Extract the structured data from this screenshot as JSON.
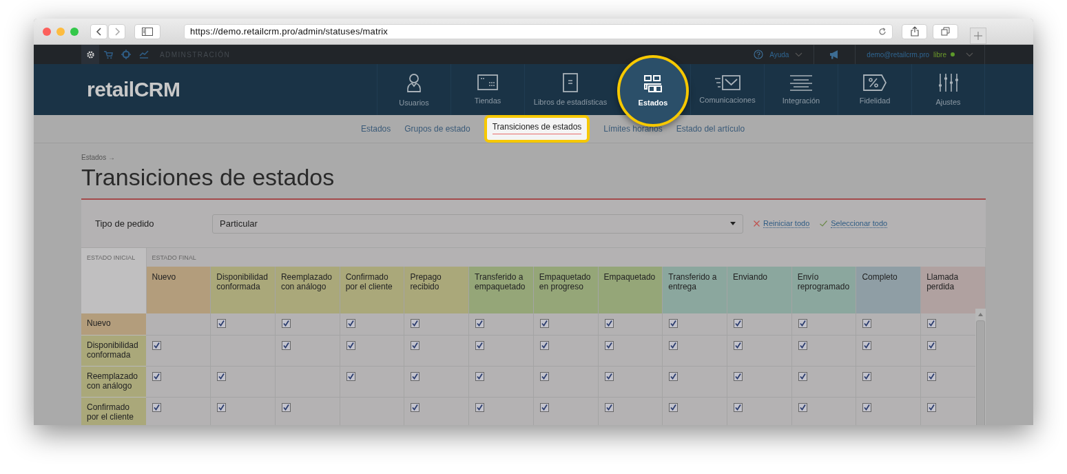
{
  "browser": {
    "url": "https://demo.retailcrm.pro/admin/statuses/matrix"
  },
  "admin_bar": {
    "tools": [
      {
        "selected": true
      },
      {
        "selected": false
      },
      {
        "selected": false
      },
      {
        "selected": false
      }
    ],
    "section": "ADMINSTRACIÓN",
    "help": "Ayuda",
    "user": "demo@retailcrm.pro",
    "plan": "libre"
  },
  "logo": "retailCRM",
  "nav": [
    {
      "label": "Usuarios",
      "selected": false
    },
    {
      "label": "Tiendas",
      "selected": false
    },
    {
      "label": "Libros de estadísticas",
      "selected": false
    },
    {
      "label": "Estados",
      "selected": true
    },
    {
      "label": "Comunicaciones",
      "selected": false
    },
    {
      "label": "Integración",
      "selected": false
    },
    {
      "label": "Fidelidad",
      "selected": false
    },
    {
      "label": "Ajustes",
      "selected": false
    }
  ],
  "subnav": [
    {
      "label": "Estados",
      "selected": false
    },
    {
      "label": "Grupos de estado",
      "selected": false
    },
    {
      "label": "Transiciones de estados",
      "selected": true
    },
    {
      "label": "Límites horarios",
      "selected": false
    },
    {
      "label": "Estado del artículo",
      "selected": false
    }
  ],
  "breadcrumb": "Estados →",
  "title": "Transiciones de estados",
  "filter": {
    "label": "Tipo de pedido",
    "value": "Particular",
    "reset": "Reiniciar todo",
    "select_all": "Seleccionar todo"
  },
  "matrix": {
    "initial_label": "ESTADO INICIAL",
    "final_label": "ESTADO FINAL",
    "columns": [
      {
        "label": "Nuevo",
        "color": "#b39d7c"
      },
      {
        "label": "Disponibilidad conformada",
        "color": "#aaa87a"
      },
      {
        "label": "Reemplazado con análogo",
        "color": "#aaa87a"
      },
      {
        "label": "Confirmado por el cliente",
        "color": "#aaa87a"
      },
      {
        "label": "Prepago recibido",
        "color": "#aaa87a"
      },
      {
        "label": "Transferido a empaquetado",
        "color": "#95a678"
      },
      {
        "label": "Empaquetado en progreso",
        "color": "#95a678"
      },
      {
        "label": "Empaquetado",
        "color": "#95a678"
      },
      {
        "label": "Transferido a entrega",
        "color": "#8ba79e"
      },
      {
        "label": "Enviando",
        "color": "#8ba79e"
      },
      {
        "label": "Envío reprogramado",
        "color": "#8ba79e"
      },
      {
        "label": "Completo",
        "color": "#8f9ea5"
      },
      {
        "label": "Llamada perdida",
        "color": "#b0a1a0"
      }
    ],
    "rows": [
      {
        "label": "Nuevo",
        "color": "#b39d7c",
        "cells": [
          {
            "kind": "empty"
          },
          {
            "kind": "checkbox",
            "checked": true
          },
          {
            "kind": "checkbox",
            "checked": true
          },
          {
            "kind": "checkbox",
            "checked": true
          },
          {
            "kind": "checkbox",
            "checked": true
          },
          {
            "kind": "checkbox",
            "checked": true
          },
          {
            "kind": "checkbox",
            "checked": true
          },
          {
            "kind": "checkbox",
            "checked": true
          },
          {
            "kind": "checkbox",
            "checked": true
          },
          {
            "kind": "checkbox",
            "checked": true
          },
          {
            "kind": "checkbox",
            "checked": true
          },
          {
            "kind": "checkbox",
            "checked": true
          },
          {
            "kind": "checkbox",
            "checked": true
          }
        ]
      },
      {
        "label": "Disponibilidad conformada",
        "color": "#aaa87a",
        "cells": [
          {
            "kind": "checkbox",
            "checked": true
          },
          {
            "kind": "empty"
          },
          {
            "kind": "checkbox",
            "checked": true
          },
          {
            "kind": "checkbox",
            "checked": true
          },
          {
            "kind": "checkbox",
            "checked": true
          },
          {
            "kind": "checkbox",
            "checked": true
          },
          {
            "kind": "checkbox",
            "checked": true
          },
          {
            "kind": "checkbox",
            "checked": true
          },
          {
            "kind": "checkbox",
            "checked": true
          },
          {
            "kind": "checkbox",
            "checked": true
          },
          {
            "kind": "checkbox",
            "checked": true
          },
          {
            "kind": "checkbox",
            "checked": true
          },
          {
            "kind": "checkbox",
            "checked": true
          }
        ]
      },
      {
        "label": "Reemplazado con análogo",
        "color": "#aaa87a",
        "cells": [
          {
            "kind": "checkbox",
            "checked": true
          },
          {
            "kind": "checkbox",
            "checked": true
          },
          {
            "kind": "empty"
          },
          {
            "kind": "checkbox",
            "checked": true
          },
          {
            "kind": "checkbox",
            "checked": true
          },
          {
            "kind": "checkbox",
            "checked": true
          },
          {
            "kind": "checkbox",
            "checked": true
          },
          {
            "kind": "checkbox",
            "checked": true
          },
          {
            "kind": "checkbox",
            "checked": true
          },
          {
            "kind": "checkbox",
            "checked": true
          },
          {
            "kind": "checkbox",
            "checked": true
          },
          {
            "kind": "checkbox",
            "checked": true
          },
          {
            "kind": "checkbox",
            "checked": true
          }
        ]
      },
      {
        "label": "Confirmado por el cliente",
        "color": "#aaa87a",
        "cells": [
          {
            "kind": "checkbox",
            "checked": true
          },
          {
            "kind": "checkbox",
            "checked": true
          },
          {
            "kind": "checkbox",
            "checked": true
          },
          {
            "kind": "empty"
          },
          {
            "kind": "checkbox",
            "checked": true
          },
          {
            "kind": "checkbox",
            "checked": true
          },
          {
            "kind": "checkbox",
            "checked": true
          },
          {
            "kind": "checkbox",
            "checked": true
          },
          {
            "kind": "checkbox",
            "checked": true
          },
          {
            "kind": "checkbox",
            "checked": true
          },
          {
            "kind": "checkbox",
            "checked": true
          },
          {
            "kind": "checkbox",
            "checked": true
          },
          {
            "kind": "checkbox",
            "checked": true
          }
        ]
      }
    ]
  }
}
